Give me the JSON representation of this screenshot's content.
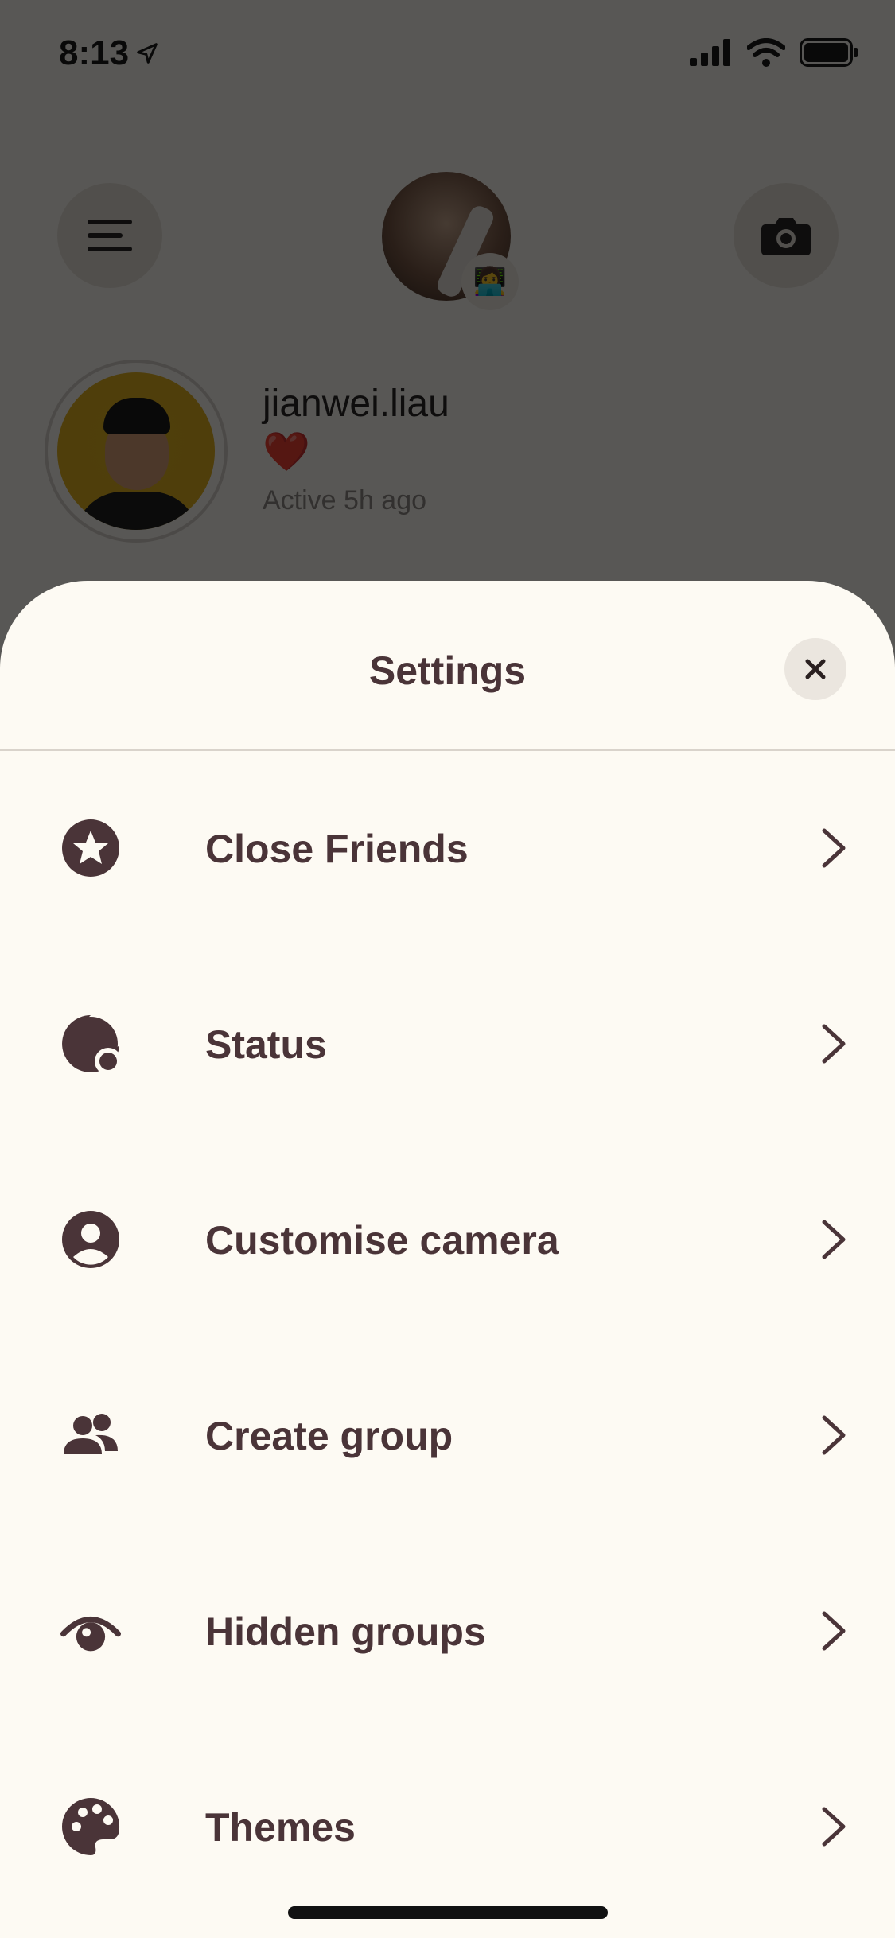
{
  "status_bar": {
    "time": "8:13",
    "icons": [
      "location-arrow-icon",
      "signal-icon",
      "wifi-icon",
      "battery-icon"
    ]
  },
  "header": {
    "menu_icon": "hamburger-menu-icon",
    "camera_icon": "camera-icon",
    "badge_emoji": "👩‍💻"
  },
  "profile": {
    "username": "jianwei.liau",
    "status_emoji": "❤️",
    "active_text": "Active 5h ago"
  },
  "sheet": {
    "title": "Settings",
    "close_icon": "close-icon",
    "items": [
      {
        "label": "Close Friends",
        "icon": "star-circle-icon"
      },
      {
        "label": "Status",
        "icon": "status-icon"
      },
      {
        "label": "Customise camera",
        "icon": "user-circle-icon"
      },
      {
        "label": "Create group",
        "icon": "group-icon"
      },
      {
        "label": "Hidden groups",
        "icon": "eye-icon"
      },
      {
        "label": "Themes",
        "icon": "palette-icon"
      }
    ]
  },
  "colors": {
    "sheet_background": "#fdfaf3",
    "text_primary": "#4a3438",
    "dim_overlay": "rgba(0,0,0,0.65)"
  }
}
